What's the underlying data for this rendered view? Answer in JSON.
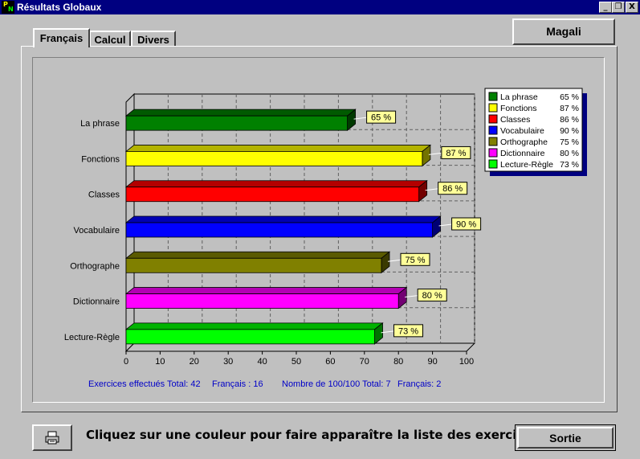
{
  "window": {
    "title": "Résultats Globaux",
    "icon_letters": [
      "P",
      "N"
    ],
    "controls": [
      "_",
      "❐",
      "X"
    ]
  },
  "tabs": [
    "Français",
    "Calcul",
    "Divers"
  ],
  "user_name": "Magali",
  "stats": {
    "exercises_total": "Exercices effectués Total: 42",
    "exercises_french": "Français : 16",
    "perfect_total": "Nombre de 100/100 Total: 7",
    "perfect_french": "Français: 2"
  },
  "hint": "Cliquez sur une couleur pour faire apparaître la liste des exercices !",
  "buttons": {
    "print_icon": "printer-icon",
    "exit": "Sortie"
  },
  "chart_data": {
    "type": "bar",
    "orientation": "horizontal",
    "categories": [
      "La phrase",
      "Fonctions",
      "Classes",
      "Vocabulaire",
      "Orthographe",
      "Dictionnaire",
      "Lecture-Règle"
    ],
    "values": [
      65,
      87,
      86,
      90,
      75,
      80,
      73
    ],
    "value_labels": [
      "65 %",
      "87 %",
      "86 %",
      "90 %",
      "75 %",
      "80 %",
      "73 %"
    ],
    "colors": [
      "#008000",
      "#ffff00",
      "#ff0000",
      "#0000ff",
      "#808000",
      "#ff00ff",
      "#00ff00"
    ],
    "xlim": [
      0,
      100
    ],
    "xticks": [
      0,
      10,
      20,
      30,
      40,
      50,
      60,
      70,
      80,
      90,
      100
    ],
    "grid": true,
    "legend_position": "right",
    "legend": [
      {
        "name": "La phrase",
        "value": "65 %"
      },
      {
        "name": "Fonctions",
        "value": "87 %"
      },
      {
        "name": "Classes",
        "value": "86 %"
      },
      {
        "name": "Vocabulaire",
        "value": "90 %"
      },
      {
        "name": "Orthographe",
        "value": "75 %"
      },
      {
        "name": "Dictionnaire",
        "value": "80 %"
      },
      {
        "name": "Lecture-Règle",
        "value": "73 %"
      }
    ]
  }
}
